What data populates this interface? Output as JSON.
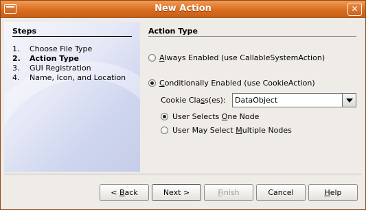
{
  "window": {
    "title": "New Action",
    "close_label": "✕"
  },
  "steps": {
    "title": "Steps",
    "items": [
      {
        "num": "1.",
        "label": "Choose File Type"
      },
      {
        "num": "2.",
        "label": "Action Type"
      },
      {
        "num": "3.",
        "label": "GUI Registration"
      },
      {
        "num": "4.",
        "label": "Name, Icon, and Location"
      }
    ],
    "current_index": 1
  },
  "panel": {
    "title": "Action Type",
    "always": {
      "pre": "",
      "mn": "A",
      "post": "lways Enabled (use CallableSystemAction)",
      "selected": false
    },
    "conditional": {
      "pre": "",
      "mn": "C",
      "post": "onditionally Enabled (use CookieAction)",
      "selected": true
    },
    "cookie": {
      "pre": "Cookie Cla",
      "mn": "s",
      "post": "s(es):",
      "value": "DataObject"
    },
    "one": {
      "pre": "User Selects ",
      "mn": "O",
      "post": "ne Node",
      "selected": true
    },
    "multi": {
      "pre": "User May Select ",
      "mn": "M",
      "post": "ultiple Nodes",
      "selected": false
    }
  },
  "buttons": {
    "back": {
      "pre": "< ",
      "mn": "B",
      "post": "ack"
    },
    "next": {
      "pre": "Next >",
      "mn": "",
      "post": ""
    },
    "finish": {
      "pre": "",
      "mn": "F",
      "post": "inish"
    },
    "cancel": {
      "pre": "Cancel",
      "mn": "",
      "post": ""
    },
    "help": {
      "pre": "",
      "mn": "H",
      "post": "elp"
    }
  }
}
